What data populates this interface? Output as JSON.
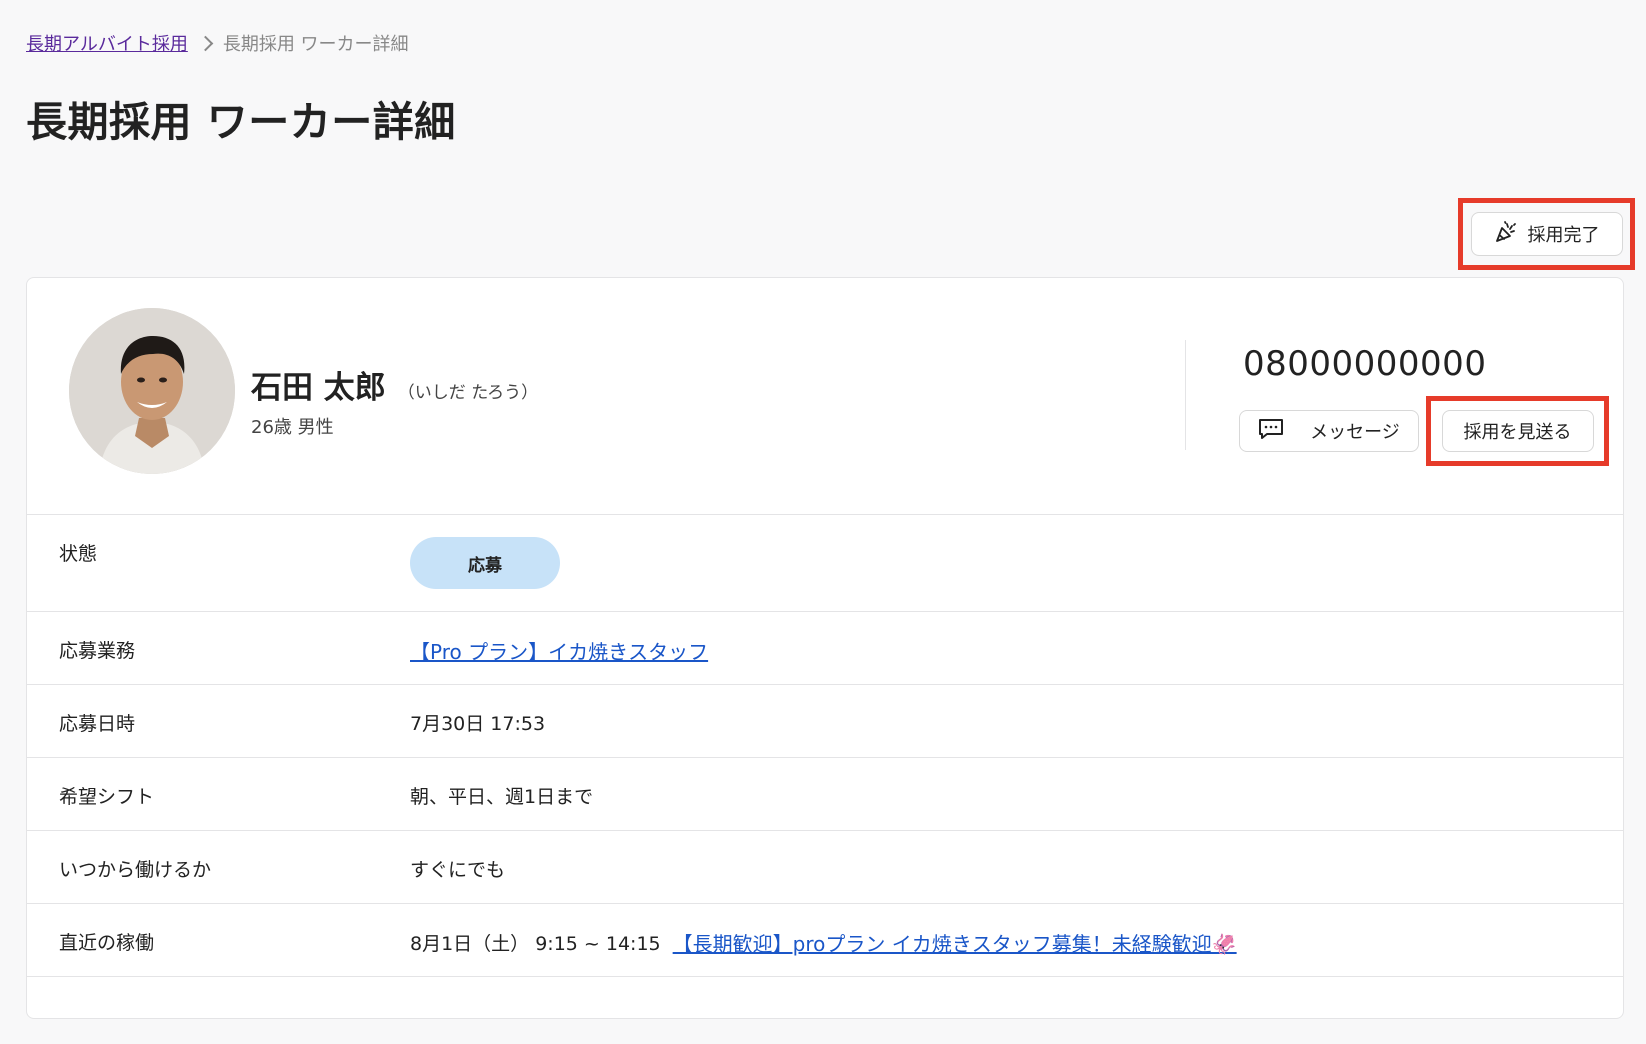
{
  "breadcrumb": {
    "parent": "長期アルバイト採用",
    "current": "長期採用 ワーカー詳細"
  },
  "page_title": "長期採用 ワーカー詳細",
  "actions": {
    "hire_complete_label": "採用完了",
    "hire_complete_icon": "party-popper-icon"
  },
  "worker": {
    "name": "石田 太郎",
    "kana": "（いしだ たろう）",
    "age_gender": "26歳 男性",
    "phone": "08000000000",
    "message_label": "メッセージ",
    "message_icon": "chat-bubble-icon",
    "pass_label": "採用を見送る"
  },
  "details": {
    "status": {
      "label": "状態",
      "value": "応募",
      "badge_color": "#c7e2f8"
    },
    "job": {
      "label": "応募業務",
      "value": "【Pro プラン】イカ焼きスタッフ"
    },
    "applied_at": {
      "label": "応募日時",
      "value": "7月30日 17:53"
    },
    "shift": {
      "label": "希望シフト",
      "value": "朝、平日、週1日まで"
    },
    "start": {
      "label": "いつから働けるか",
      "value": "すぐにでも"
    },
    "recent": {
      "label": "直近の稼働",
      "datetime": "8月1日（土） 9:15 ~ 14:15",
      "job_link": "【長期歓迎】proプラン イカ焼きスタッフ募集！未経験歓迎🦑"
    }
  },
  "colors": {
    "highlight": "#e63b2a",
    "link": "#1a56c8",
    "breadcrumb_link": "#5a2a9c"
  }
}
